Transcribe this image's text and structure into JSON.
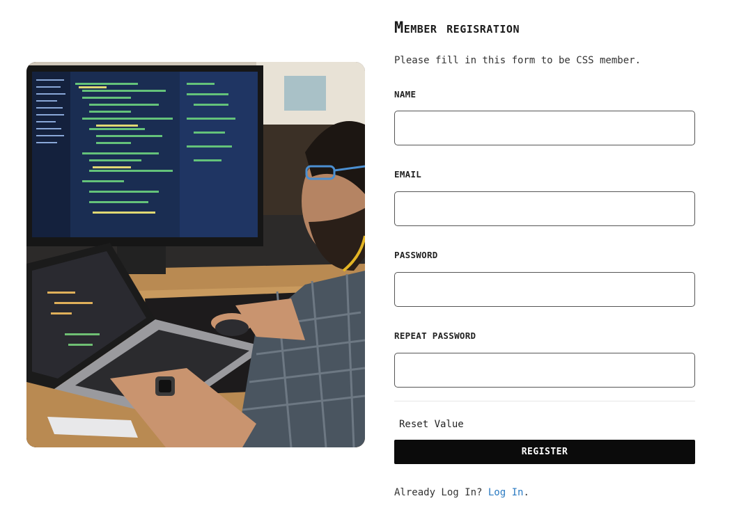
{
  "form": {
    "title": "Member regisration",
    "subtitle": "Please fill in this form to be CSS member.",
    "fields": [
      {
        "label": "NAME",
        "value": "",
        "placeholder": ""
      },
      {
        "label": "EMAIL",
        "value": "",
        "placeholder": ""
      },
      {
        "label": "PASSWORD",
        "value": "",
        "placeholder": ""
      },
      {
        "label": "REPEAT PASSWORD",
        "value": "",
        "placeholder": ""
      }
    ],
    "reset_label": "Reset Value",
    "register_label": "REGISTER",
    "login_prompt": "Already Log In?",
    "login_link": "Log In",
    "login_suffix": "."
  },
  "photo": {
    "icon": "developer-workspace-photo"
  },
  "colors": {
    "button_bg": "#0b0b0b",
    "button_text": "#ffffff",
    "link": "#2a7ac2",
    "input_border": "#555555"
  }
}
